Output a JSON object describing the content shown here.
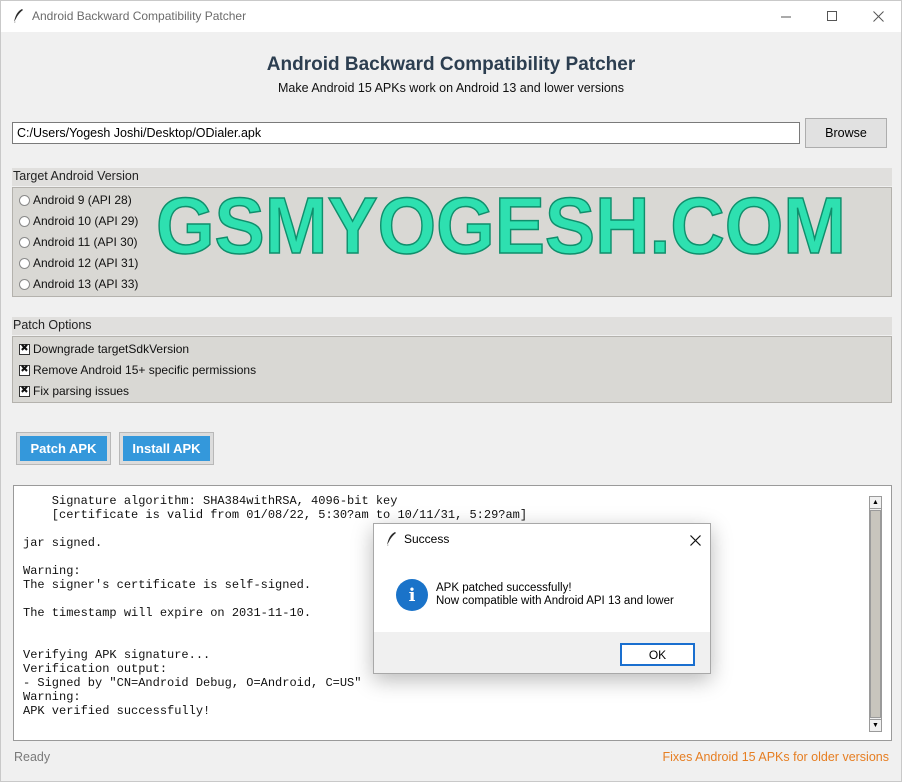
{
  "window": {
    "title": "Android Backward Compatibility Patcher",
    "app_icon": "feather-icon"
  },
  "header": {
    "title": "Android Backward Compatibility Patcher",
    "subtitle": "Make Android 15 APKs work on Android 13 and lower versions"
  },
  "file": {
    "path_value": "C:/Users/Yogesh Joshi/Desktop/ODialer.apk",
    "browse_label": "Browse"
  },
  "target": {
    "label": "Target Android Version",
    "options": [
      "Android 9 (API 28)",
      "Android 10 (API 29)",
      "Android 11 (API 30)",
      "Android 12 (API 31)",
      "Android 13 (API 33)"
    ]
  },
  "watermark": {
    "text": "GSMYOGESH.COM",
    "color": "#2ee0b0"
  },
  "patch_options": {
    "label": "Patch Options",
    "items": [
      {
        "label": "Downgrade targetSdkVersion",
        "checked": true
      },
      {
        "label": "Remove Android 15+ specific permissions",
        "checked": true
      },
      {
        "label": "Fix parsing issues",
        "checked": true
      }
    ]
  },
  "actions": {
    "patch_label": "Patch APK",
    "install_label": "Install APK",
    "color": "#3498db"
  },
  "log": {
    "text": "    Signature algorithm: SHA384withRSA, 4096-bit key\n    [certificate is valid from 01/08/22, 5:30?am to 10/11/31, 5:29?am]\n\njar signed.\n\nWarning:\nThe signer's certificate is self-signed.\n\nThe timestamp will expire on 2031-11-10.\n\n\nVerifying APK signature...\nVerification output:\n- Signed by \"CN=Android Debug, O=Android, C=US\"\nWarning:\nAPK verified successfully!"
  },
  "status": {
    "left": "Ready",
    "right": "Fixes Android 15 APKs for older versions",
    "right_color": "#e67e22"
  },
  "dialog": {
    "title": "Success",
    "line1": "APK patched successfully!",
    "line2": "Now compatible with Android API 13 and lower",
    "ok_label": "OK",
    "icon": "info-icon"
  }
}
